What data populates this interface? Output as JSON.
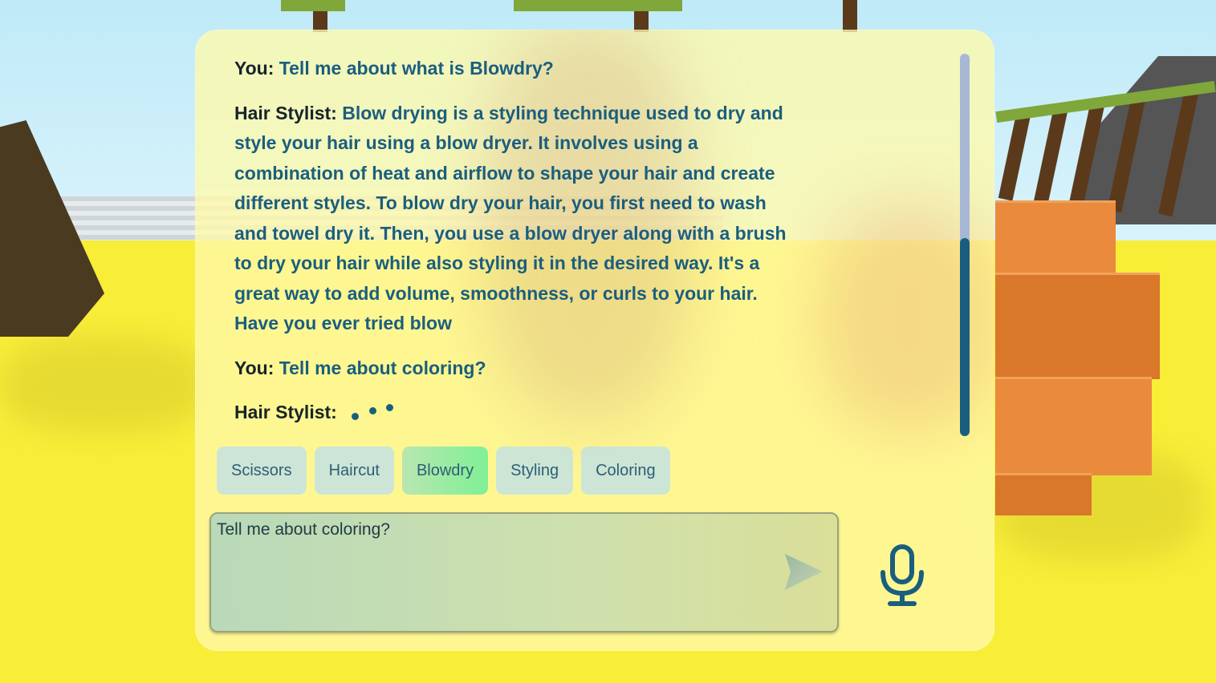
{
  "chat": {
    "messages": [
      {
        "speaker": "You:",
        "text": "Tell me about what is Blowdry?"
      },
      {
        "speaker": "Hair Stylist:",
        "text": "Blow drying is a styling technique used to dry and style your hair using a blow dryer. It involves using a combination of heat and airflow to shape your hair and create different styles. To blow dry your hair, you first need to wash and towel dry it. Then, you use a blow dryer along with a brush to dry your hair while also styling it in the desired way. It's a great way to add volume, smoothness, or curls to your hair. Have you ever tried blow"
      },
      {
        "speaker": "You:",
        "text": "Tell me about coloring?"
      },
      {
        "speaker": "Hair Stylist:",
        "text": ""
      }
    ]
  },
  "topics": [
    {
      "label": "Scissors",
      "active": false
    },
    {
      "label": "Haircut",
      "active": false
    },
    {
      "label": "Blowdry",
      "active": true
    },
    {
      "label": "Styling",
      "active": false
    },
    {
      "label": "Coloring",
      "active": false
    }
  ],
  "input": {
    "value": "Tell me about coloring?"
  },
  "icons": {
    "send": "send-arrow-icon",
    "mic": "microphone-icon",
    "typing": "typing-indicator-icon"
  },
  "colors": {
    "accent": "#1a5e7f",
    "speaker": "#16232b",
    "panel": "#fffaa6",
    "active_chip": "#7ff096",
    "chip": "#c4e2e2"
  }
}
